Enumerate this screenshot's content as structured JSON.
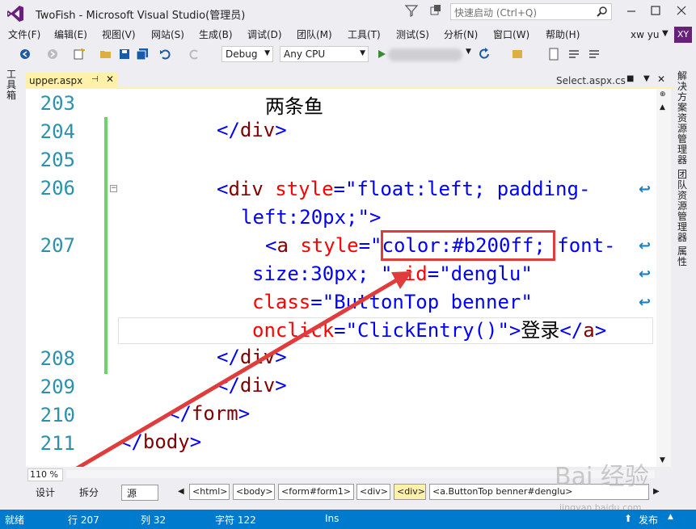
{
  "window": {
    "title": "TwoFish - Microsoft Visual Studio(管理员)",
    "quick_launch_placeholder": "快速启动 (Ctrl+Q)",
    "user_name": "xw yu",
    "user_initials": "XY",
    "accent_color": "#68217a"
  },
  "menu": {
    "items": [
      "文件(F)",
      "编辑(E)",
      "视图(V)",
      "网站(S)",
      "生成(B)",
      "调试(D)",
      "团队(M)",
      "工具(T)",
      "测试(S)",
      "分析(N)",
      "窗口(W)",
      "帮助(H)"
    ]
  },
  "toolbar": {
    "configuration": "Debug",
    "platform": "Any CPU"
  },
  "left_panel": {
    "toolbox_label": "工具箱"
  },
  "right_panel": {
    "tabs": [
      "解决方案资源管理器",
      "团队资源管理器",
      "属性"
    ]
  },
  "tabs": {
    "active": "upper.aspx",
    "preview": "Select.aspx.cs"
  },
  "editor": {
    "lines": [
      {
        "number": "203",
        "text": "两条鱼"
      },
      {
        "number": "204",
        "text": "</div>"
      },
      {
        "number": "205",
        "text": ""
      },
      {
        "number": "206",
        "text": "<div style=\"float:left; padding-left:20px;\">"
      },
      {
        "number": "207",
        "text": "<a style=\"color:#b200ff; font-size:30px; \" id=\"denglu\" class=\"ButtonTop benner\" onclick=\"ClickEntry()\">登录</a>"
      },
      {
        "number": "208",
        "text": "</div>"
      },
      {
        "number": "209",
        "text": "</div>"
      },
      {
        "number": "210",
        "text": "</form>"
      },
      {
        "number": "211",
        "text": "</body>"
      }
    ],
    "highlighted_text": "color:#b200ff;",
    "highlight_color": "#e03c3c",
    "zoom": "110 %"
  },
  "views": {
    "design": "设计",
    "split": "拆分",
    "source": "源"
  },
  "breadcrumbs": [
    "<html>",
    "<body>",
    "<form#form1>",
    "<div>",
    "<div>",
    "<a.ButtonTop benner#denglu>"
  ],
  "status": {
    "state": "就绪",
    "line": "行 207",
    "column": "列 32",
    "char": "字符 122",
    "mode": "Ins",
    "publish": "发布",
    "bar_color": "#007acc"
  },
  "watermark": {
    "brand": "Bai 经验",
    "url": "jingyan.baidu.com"
  }
}
